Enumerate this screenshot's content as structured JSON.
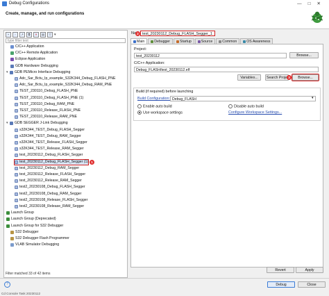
{
  "window": {
    "title": "Debug Configurations",
    "controls": [
      "—",
      "□",
      "✕"
    ]
  },
  "header": {
    "heading": "Create, manage, and run configurations"
  },
  "left": {
    "filter_placeholder": "type filter text",
    "tree": [
      {
        "label": "C/C++ Application",
        "depth": 1,
        "icon": "cc"
      },
      {
        "label": "C/C++ Remote Application",
        "depth": 1,
        "icon": "rem"
      },
      {
        "label": "Eclipse Application",
        "depth": 1,
        "icon": "ecl"
      },
      {
        "label": "GDB Hardware Debugging",
        "depth": 1,
        "icon": "gdb"
      },
      {
        "label": "GDB PEMicro Interface Debugging",
        "depth": 0,
        "icon": "gdb",
        "twisty": "▾"
      },
      {
        "label": "Adc_Sar_Bctu_Ip_example_S32K344_Debug_FLASH_PNE",
        "depth": 2,
        "icon": "cfg"
      },
      {
        "label": "Adc_Sar_Bctu_Ip_example_S32K344_Debug_RAM_PNE",
        "depth": 2,
        "icon": "cfg"
      },
      {
        "label": "TEST_230110_Debug_FLASH_PNE",
        "depth": 2,
        "icon": "cfg"
      },
      {
        "label": "TEST_230110_Debug_FLASH_PNE (1)",
        "depth": 2,
        "icon": "cfg"
      },
      {
        "label": "TEST_230110_Debug_RAM_PNE",
        "depth": 2,
        "icon": "cfg"
      },
      {
        "label": "TEST_230110_Release_FLASH_PNE",
        "depth": 2,
        "icon": "cfg"
      },
      {
        "label": "TEST_230110_Release_RAM_PNE",
        "depth": 2,
        "icon": "cfg"
      },
      {
        "label": "GDB SEGGER J-Link Debugging",
        "depth": 0,
        "icon": "gdb",
        "twisty": "▾"
      },
      {
        "label": "s32K344_TEST_Debug_FLASH_Segger",
        "depth": 2,
        "icon": "cfg"
      },
      {
        "label": "s32K344_TEST_Debug_RAM_Segger",
        "depth": 2,
        "icon": "cfg"
      },
      {
        "label": "s32K344_TEST_Release_FLASH_Segger",
        "depth": 2,
        "icon": "cfg"
      },
      {
        "label": "s32K344_TEST_Release_RAM_Segger",
        "depth": 2,
        "icon": "cfg"
      },
      {
        "label": "test_20230112_Debug_FLASH_Segger",
        "depth": 2,
        "icon": "cfg"
      },
      {
        "label": "test_20230112_Debug_FLASH_Segger (1)",
        "depth": 2,
        "icon": "cfg",
        "selected": true,
        "marker": "1"
      },
      {
        "label": "test_20230112_Debug_RAM_Segger",
        "depth": 2,
        "icon": "cfg"
      },
      {
        "label": "test_20230112_Release_FLASH_Segger",
        "depth": 2,
        "icon": "cfg"
      },
      {
        "label": "test_20230112_Release_RAM_Segger",
        "depth": 2,
        "icon": "cfg"
      },
      {
        "label": "test2_20230108_Debug_FLASH_Segger",
        "depth": 2,
        "icon": "cfg"
      },
      {
        "label": "test2_20230108_Debug_RAM_Segger",
        "depth": 2,
        "icon": "cfg"
      },
      {
        "label": "test2_20230108_Release_FLASH_Segger",
        "depth": 2,
        "icon": "cfg"
      },
      {
        "label": "test2_20230108_Release_RAM_Segger",
        "depth": 2,
        "icon": "cfg"
      },
      {
        "label": "Launch Group",
        "depth": 0,
        "icon": "lg"
      },
      {
        "label": "Launch Group (Deprecated)",
        "depth": 0,
        "icon": "lg"
      },
      {
        "label": "Launch Group for S32 Debugger",
        "depth": 0,
        "icon": "lg"
      },
      {
        "label": "S32 Debugger",
        "depth": 1,
        "icon": "s32"
      },
      {
        "label": "S32 Debugger Flash Programmer",
        "depth": 1,
        "icon": "s32"
      },
      {
        "label": "VLAB Simulator Debugging",
        "depth": 1,
        "icon": "vl"
      }
    ],
    "status": "Filter matched 33 of 42 items"
  },
  "right": {
    "name_label": "Na",
    "name_value": "test_20230112_Debug_FLASH_Segger_1",
    "name_marker": "2",
    "tabs": [
      {
        "label": "Main",
        "active": true,
        "color": "#3a6fc9"
      },
      {
        "label": "Debugger",
        "active": false,
        "color": "#5e8e3a"
      },
      {
        "label": "Startup",
        "active": false,
        "color": "#c56b2a"
      },
      {
        "label": "Source",
        "active": false,
        "color": "#7a5aa8"
      },
      {
        "label": "Common",
        "active": false,
        "color": "#888888"
      },
      {
        "label": "OS Awareness",
        "active": false,
        "color": "#3a8aa8"
      }
    ],
    "project_label": "Project:",
    "project_value": "test_20230112",
    "browse1": "Browse...",
    "app_label": "C/C++ Application:",
    "app_value": "Debug_FLASH/test_20230112.elf",
    "variables": "Variables...",
    "search_project": "Search Proje",
    "browse2": "Browse...",
    "browse_marker": "3",
    "build_label": "Build (if required) before launching",
    "build_config_label": "Build Configuration:",
    "build_config_value": "Debug_FLASH",
    "enable_auto": "Enable auto build",
    "disable_auto": "Disable auto build",
    "workspace": "Use workspace settings",
    "configure_ws": "Configure Workspace Settings...",
    "revert": "Revert",
    "apply": "Apply"
  },
  "footer": {
    "help": "?",
    "debug": "Debug",
    "close": "Close",
    "console": "Cd Console Task 20230112",
    "watermark": "CSDN @\u0000"
  }
}
